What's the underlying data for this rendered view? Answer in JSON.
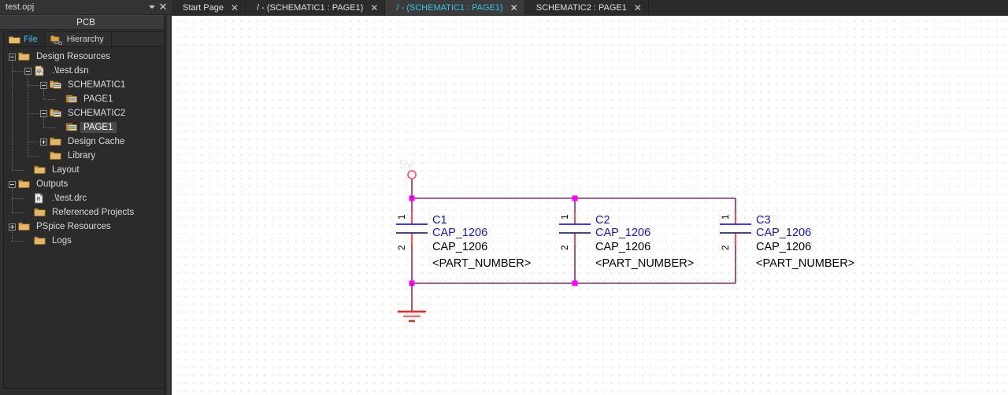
{
  "window": {
    "title": "test.opj",
    "dropdown_icon": "chevron-down-icon",
    "close_icon": "close-icon"
  },
  "panel": {
    "header": "PCB",
    "tabs": [
      {
        "label": "File",
        "icon": "folder-icon",
        "active": true
      },
      {
        "label": "Hierarchy",
        "icon": "hierarchy-icon",
        "active": false
      }
    ]
  },
  "tree": {
    "nodes": [
      {
        "label": "Design Resources",
        "depth": 0,
        "expander": "minus",
        "icon": "folder-icon",
        "selected": false
      },
      {
        "label": ".\\test.dsn",
        "depth": 1,
        "expander": "minus",
        "icon": "dsn-file-icon",
        "selected": false
      },
      {
        "label": "SCHEMATIC1",
        "depth": 2,
        "expander": "minus",
        "icon": "schematic-folder-icon",
        "selected": false
      },
      {
        "label": "PAGE1",
        "depth": 3,
        "expander": "none",
        "icon": "page-icon",
        "selected": false
      },
      {
        "label": "SCHEMATIC2",
        "depth": 2,
        "expander": "minus",
        "icon": "schematic-folder-icon",
        "selected": false
      },
      {
        "label": "PAGE1",
        "depth": 3,
        "expander": "none",
        "icon": "page-icon",
        "selected": true
      },
      {
        "label": "Design Cache",
        "depth": 2,
        "expander": "plus",
        "icon": "folder-icon",
        "selected": false
      },
      {
        "label": "Library",
        "depth": 2,
        "expander": "none",
        "icon": "folder-icon",
        "selected": false
      },
      {
        "label": "Layout",
        "depth": 1,
        "expander": "none",
        "icon": "folder-icon",
        "selected": false
      },
      {
        "label": "Outputs",
        "depth": 0,
        "expander": "minus",
        "icon": "folder-icon",
        "selected": false
      },
      {
        "label": ".\\test.drc",
        "depth": 1,
        "expander": "none",
        "icon": "drc-file-icon",
        "selected": false
      },
      {
        "label": "Referenced Projects",
        "depth": 1,
        "expander": "none",
        "icon": "folder-icon",
        "selected": false
      },
      {
        "label": "PSpice Resources",
        "depth": 0,
        "expander": "plus",
        "icon": "folder-icon",
        "selected": false
      },
      {
        "label": "Logs",
        "depth": 1,
        "expander": "none",
        "icon": "folder-icon",
        "selected": false
      }
    ]
  },
  "document_tabs": [
    {
      "label": "Start Page",
      "close_icon": "close-icon",
      "active": false
    },
    {
      "label": "/ - (SCHEMATIC1 : PAGE1)",
      "close_icon": "close-icon",
      "active": false
    },
    {
      "label": "/ - (SCHEMATIC1 : PAGE1)",
      "close_icon": "close-icon",
      "active": true
    },
    {
      "label": "SCHEMATIC2 : PAGE1",
      "close_icon": "close-icon",
      "active": false
    }
  ],
  "schematic": {
    "net_label": "5V",
    "ground_symbol": "ground-icon",
    "components": [
      {
        "refdes": "C1",
        "value": "CAP_1206",
        "footprint": "CAP_1206",
        "part_number": "<PART_NUMBER>",
        "pin_top": "1",
        "pin_bottom": "2"
      },
      {
        "refdes": "C2",
        "value": "CAP_1206",
        "footprint": "CAP_1206",
        "part_number": "<PART_NUMBER>",
        "pin_top": "1",
        "pin_bottom": "2"
      },
      {
        "refdes": "C3",
        "value": "CAP_1206",
        "footprint": "CAP_1206",
        "part_number": "<PART_NUMBER>",
        "pin_top": "1",
        "pin_bottom": "2"
      }
    ]
  },
  "colors": {
    "wire": "#8B2C6B",
    "lead": "#FF2020",
    "plate": "#2020E0",
    "junction": "#FF00FF",
    "refdes_text": "#1515CC",
    "value_text": "#000000",
    "accent": "#35c5f0",
    "canvas": "#ffffff"
  }
}
